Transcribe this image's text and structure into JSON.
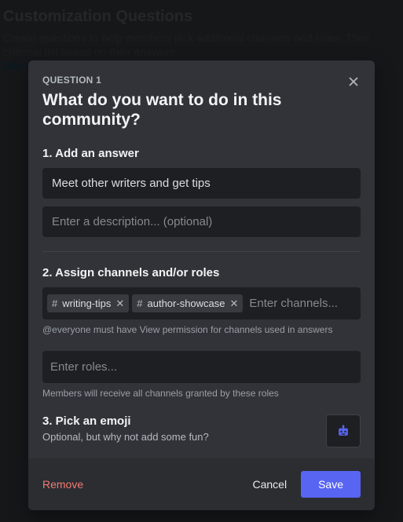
{
  "background": {
    "title": "Customization Questions",
    "subtitle": "Create questions to help members pick additional channels and roles. Their channel list based on their answers.",
    "link": "See e"
  },
  "modal": {
    "eyebrow": "QUESTION 1",
    "title": "What do you want to do in this community?",
    "step1": {
      "label": "1. Add an answer",
      "answer_value": "Meet other writers and get tips",
      "description_placeholder": "Enter a description... (optional)"
    },
    "step2": {
      "label": "2. Assign channels and/or roles",
      "channels": [
        "writing-tips",
        "author-showcase"
      ],
      "channels_placeholder": "Enter channels...",
      "channels_helper": "@everyone must have View permission for channels used in answers",
      "roles_placeholder": "Enter roles...",
      "roles_helper": "Members will receive all channels granted by these roles"
    },
    "step3": {
      "label": "3. Pick an emoji",
      "subtitle": "Optional, but why not add some fun?"
    },
    "footer": {
      "remove": "Remove",
      "cancel": "Cancel",
      "save": "Save"
    }
  }
}
